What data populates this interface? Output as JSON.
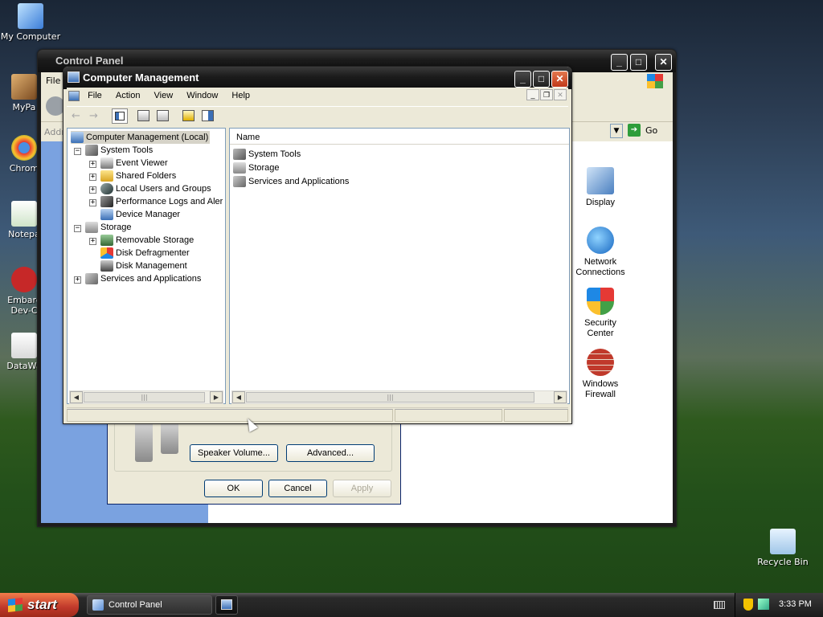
{
  "desktop": {
    "icons": [
      {
        "label": "My Computer"
      },
      {
        "label": "MyPa"
      },
      {
        "label": "Chrom"
      },
      {
        "label": "Notepa"
      },
      {
        "label": "Embarc Dev-C"
      },
      {
        "label": "DataWa"
      },
      {
        "label": "Recycle Bin"
      }
    ]
  },
  "control_panel": {
    "title": "Control Panel",
    "menu_first": "File",
    "address_label": "Addr",
    "go_label": "Go",
    "icons": [
      {
        "label": "Display"
      },
      {
        "label": "Network Connections"
      },
      {
        "label": "Security Center"
      },
      {
        "label": "Windows Firewall"
      }
    ],
    "dialog": {
      "speaker_volume": "Speaker Volume...",
      "advanced": "Advanced...",
      "ok": "OK",
      "cancel": "Cancel",
      "apply": "Apply"
    }
  },
  "cm": {
    "title": "Computer Management",
    "menu": [
      "File",
      "Action",
      "View",
      "Window",
      "Help"
    ],
    "tree": [
      {
        "label": "Computer Management (Local)"
      },
      {
        "label": "System Tools"
      },
      {
        "label": "Event Viewer"
      },
      {
        "label": "Shared Folders"
      },
      {
        "label": "Local Users and Groups"
      },
      {
        "label": "Performance Logs and Alerts"
      },
      {
        "label": "Device Manager"
      },
      {
        "label": "Storage"
      },
      {
        "label": "Removable Storage"
      },
      {
        "label": "Disk Defragmenter"
      },
      {
        "label": "Disk Management"
      },
      {
        "label": "Services and Applications"
      }
    ],
    "list_header": "Name",
    "list": [
      {
        "label": "System Tools"
      },
      {
        "label": "Storage"
      },
      {
        "label": "Services and Applications"
      }
    ]
  },
  "taskbar": {
    "start": "start",
    "tasks": [
      {
        "label": "Control Panel"
      }
    ],
    "clock": "3:33 PM"
  }
}
